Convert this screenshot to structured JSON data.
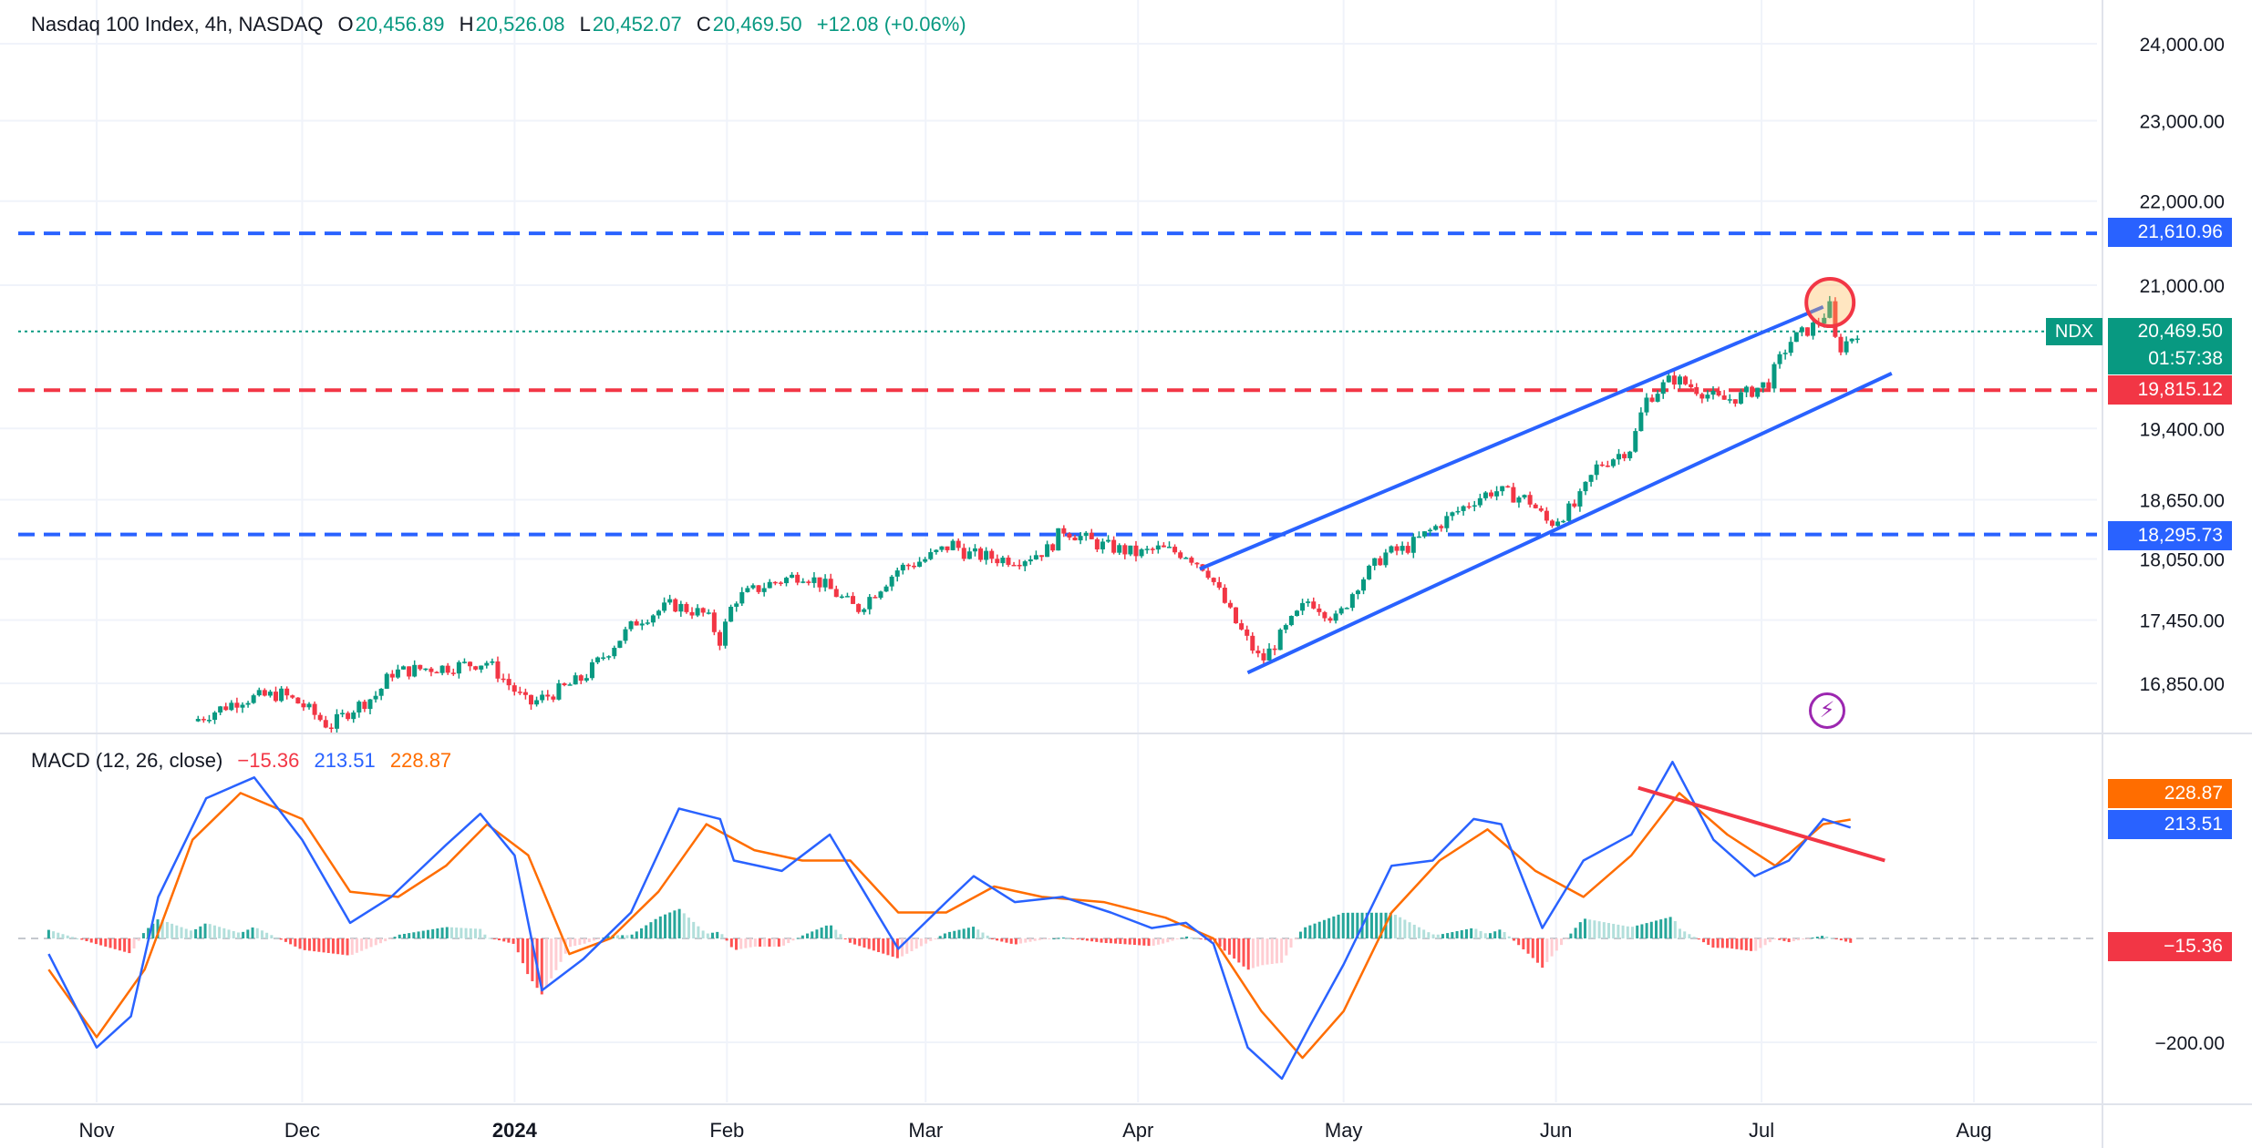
{
  "header": {
    "symbol": "Nasdaq 100 Index, 4h, NASDAQ",
    "o_label": "O",
    "o_val": "20,456.89",
    "h_label": "H",
    "h_val": "20,526.08",
    "l_label": "L",
    "l_val": "20,452.07",
    "c_label": "C",
    "c_val": "20,469.50",
    "change": "+12.08 (+0.06%)"
  },
  "macd_header": {
    "label": "MACD (12, 26, close)",
    "hist": "−15.36",
    "macd": "213.51",
    "signal": "228.87"
  },
  "price_tags": {
    "resistance_upper": "21,610.96",
    "resistance_red": "19,815.12",
    "support_lower": "18,295.73",
    "symbol": "NDX",
    "last": "20,469.50",
    "countdown": "01:57:38",
    "macd_signal": "228.87",
    "macd_line": "213.51",
    "macd_hist": "−15.36"
  },
  "colors": {
    "up": "#089981",
    "down": "#f23645",
    "blue_line": "#2962ff",
    "red_line": "#f23645",
    "macd_line": "#2962ff",
    "signal_line": "#ff6d00",
    "signal_tag": "#ff6d00",
    "bolt": "#9c27b0"
  },
  "icons": {
    "indicator": "bolt-icon"
  },
  "chart_data": [
    {
      "type": "candlestick",
      "title": "Nasdaq 100 Index, 4h, NASDAQ",
      "x_ticks": [
        "Nov",
        "Dec",
        "2024",
        "Feb",
        "Mar",
        "Apr",
        "May",
        "Jun",
        "Jul",
        "Aug"
      ],
      "y_ticks": [
        24000,
        23000,
        22000,
        21000,
        19400,
        18650,
        18050,
        17450,
        16850
      ],
      "y_tick_labels": [
        "24,000.00",
        "23,000.00",
        "22,000.00",
        "21,000.00",
        "19,400.00",
        "18,650.00",
        "18,050.00",
        "17,450.00",
        "16,850.00"
      ],
      "scale": "log",
      "horizontal_levels": [
        {
          "value": 21610.96,
          "color": "#2962ff",
          "style": "dashed"
        },
        {
          "value": 19815.12,
          "color": "#f23645",
          "style": "dashed"
        },
        {
          "value": 18295.73,
          "color": "#2962ff",
          "style": "dashed"
        },
        {
          "value": 20469.5,
          "color": "#089981",
          "style": "dotted"
        }
      ],
      "channel": {
        "upper": [
          [
            "2024-04-10",
            17950
          ],
          [
            "2024-07-10",
            20750
          ]
        ],
        "lower": [
          [
            "2024-04-17",
            16950
          ],
          [
            "2024-07-20",
            20000
          ]
        ]
      },
      "highlight_circle": {
        "date": "2024-07-11",
        "value": 20800
      },
      "closes": [
        [
          "2023-11-15",
          16500
        ],
        [
          "2023-11-22",
          16700
        ],
        [
          "2023-11-28",
          16750
        ],
        [
          "2023-12-01",
          16650
        ],
        [
          "2023-12-05",
          16450
        ],
        [
          "2023-12-08",
          16600
        ],
        [
          "2023-12-12",
          16750
        ],
        [
          "2023-12-14",
          16950
        ],
        [
          "2023-12-19",
          16990
        ],
        [
          "2023-12-22",
          17000
        ],
        [
          "2023-12-28",
          17050
        ],
        [
          "2024-01-03",
          16650
        ],
        [
          "2024-01-08",
          16800
        ],
        [
          "2024-01-11",
          16900
        ],
        [
          "2024-01-16",
          17250
        ],
        [
          "2024-01-19",
          17450
        ],
        [
          "2024-01-24",
          17600
        ],
        [
          "2024-01-29",
          17500
        ],
        [
          "2024-01-31",
          17250
        ],
        [
          "2024-02-02",
          17650
        ],
        [
          "2024-02-07",
          17800
        ],
        [
          "2024-02-12",
          17900
        ],
        [
          "2024-02-15",
          17800
        ],
        [
          "2024-02-20",
          17550
        ],
        [
          "2024-02-26",
          17950
        ],
        [
          "2024-03-01",
          18050
        ],
        [
          "2024-03-05",
          18200
        ],
        [
          "2024-03-07",
          18100
        ],
        [
          "2024-03-12",
          18050
        ],
        [
          "2024-03-15",
          18050
        ],
        [
          "2024-03-19",
          18150
        ],
        [
          "2024-03-21",
          18350
        ],
        [
          "2024-03-26",
          18200
        ],
        [
          "2024-04-01",
          18100
        ],
        [
          "2024-04-04",
          18150
        ],
        [
          "2024-04-08",
          18100
        ],
        [
          "2024-04-11",
          17950
        ],
        [
          "2024-04-15",
          17450
        ],
        [
          "2024-04-19",
          17050
        ],
        [
          "2024-04-23",
          17400
        ],
        [
          "2024-04-26",
          17650
        ],
        [
          "2024-04-30",
          17450
        ],
        [
          "2024-05-03",
          17800
        ],
        [
          "2024-05-07",
          18100
        ],
        [
          "2024-05-10",
          18150
        ],
        [
          "2024-05-15",
          18400
        ],
        [
          "2024-05-20",
          18650
        ],
        [
          "2024-05-23",
          18750
        ],
        [
          "2024-05-28",
          18650
        ],
        [
          "2024-05-31",
          18400
        ],
        [
          "2024-06-04",
          18600
        ],
        [
          "2024-06-07",
          19000
        ],
        [
          "2024-06-12",
          19200
        ],
        [
          "2024-06-14",
          19700
        ],
        [
          "2024-06-18",
          19950
        ],
        [
          "2024-06-21",
          19850
        ],
        [
          "2024-06-25",
          19700
        ],
        [
          "2024-06-28",
          19750
        ],
        [
          "2024-07-02",
          19900
        ],
        [
          "2024-07-05",
          20350
        ],
        [
          "2024-07-09",
          20550
        ],
        [
          "2024-07-11",
          20750
        ],
        [
          "2024-07-12",
          20250
        ],
        [
          "2024-07-15",
          20469.5
        ]
      ]
    },
    {
      "type": "macd",
      "title": "MACD (12, 26, close)",
      "y_ticks": [
        -200
      ],
      "y_tick_labels": [
        "−200.00"
      ],
      "last": {
        "hist": -15.36,
        "macd": 213.51,
        "signal": 228.87
      },
      "divergence_line": [
        [
          "2024-06-13",
          290
        ],
        [
          "2024-07-19",
          150
        ]
      ],
      "macd": [
        [
          "2023-10-25",
          -30
        ],
        [
          "2023-11-01",
          -210
        ],
        [
          "2023-11-06",
          -150
        ],
        [
          "2023-11-10",
          80
        ],
        [
          "2023-11-17",
          270
        ],
        [
          "2023-11-24",
          310
        ],
        [
          "2023-12-01",
          190
        ],
        [
          "2023-12-08",
          30
        ],
        [
          "2023-12-14",
          80
        ],
        [
          "2023-12-22",
          180
        ],
        [
          "2023-12-27",
          240
        ],
        [
          "2024-01-01",
          160
        ],
        [
          "2024-01-05",
          -100
        ],
        [
          "2024-01-11",
          -40
        ],
        [
          "2024-01-18",
          50
        ],
        [
          "2024-01-25",
          250
        ],
        [
          "2024-01-31",
          230
        ],
        [
          "2024-02-02",
          150
        ],
        [
          "2024-02-09",
          130
        ],
        [
          "2024-02-16",
          200
        ],
        [
          "2024-02-21",
          90
        ],
        [
          "2024-02-26",
          -20
        ],
        [
          "2024-03-04",
          70
        ],
        [
          "2024-03-08",
          120
        ],
        [
          "2024-03-14",
          70
        ],
        [
          "2024-03-21",
          80
        ],
        [
          "2024-03-28",
          50
        ],
        [
          "2024-04-03",
          20
        ],
        [
          "2024-04-08",
          30
        ],
        [
          "2024-04-12",
          -10
        ],
        [
          "2024-04-17",
          -210
        ],
        [
          "2024-04-22",
          -270
        ],
        [
          "2024-04-26",
          -170
        ],
        [
          "2024-05-01",
          -50
        ],
        [
          "2024-05-08",
          140
        ],
        [
          "2024-05-14",
          150
        ],
        [
          "2024-05-20",
          230
        ],
        [
          "2024-05-24",
          220
        ],
        [
          "2024-05-30",
          20
        ],
        [
          "2024-06-05",
          150
        ],
        [
          "2024-06-12",
          200
        ],
        [
          "2024-06-18",
          340
        ],
        [
          "2024-06-24",
          190
        ],
        [
          "2024-06-30",
          120
        ],
        [
          "2024-07-05",
          150
        ],
        [
          "2024-07-10",
          230
        ],
        [
          "2024-07-14",
          213.51
        ]
      ],
      "signal": [
        [
          "2023-10-25",
          -60
        ],
        [
          "2023-11-01",
          -190
        ],
        [
          "2023-11-08",
          -60
        ],
        [
          "2023-11-15",
          190
        ],
        [
          "2023-11-22",
          280
        ],
        [
          "2023-12-01",
          230
        ],
        [
          "2023-12-08",
          90
        ],
        [
          "2023-12-15",
          80
        ],
        [
          "2023-12-22",
          140
        ],
        [
          "2023-12-28",
          220
        ],
        [
          "2024-01-03",
          160
        ],
        [
          "2024-01-09",
          -30
        ],
        [
          "2024-01-15",
          0
        ],
        [
          "2024-01-22",
          90
        ],
        [
          "2024-01-29",
          220
        ],
        [
          "2024-02-05",
          170
        ],
        [
          "2024-02-12",
          150
        ],
        [
          "2024-02-19",
          150
        ],
        [
          "2024-02-26",
          50
        ],
        [
          "2024-03-04",
          50
        ],
        [
          "2024-03-11",
          100
        ],
        [
          "2024-03-18",
          80
        ],
        [
          "2024-03-27",
          70
        ],
        [
          "2024-04-05",
          40
        ],
        [
          "2024-04-12",
          0
        ],
        [
          "2024-04-19",
          -140
        ],
        [
          "2024-04-25",
          -230
        ],
        [
          "2024-05-01",
          -140
        ],
        [
          "2024-05-08",
          50
        ],
        [
          "2024-05-15",
          150
        ],
        [
          "2024-05-22",
          210
        ],
        [
          "2024-05-29",
          130
        ],
        [
          "2024-06-05",
          80
        ],
        [
          "2024-06-12",
          160
        ],
        [
          "2024-06-19",
          280
        ],
        [
          "2024-06-26",
          200
        ],
        [
          "2024-07-03",
          140
        ],
        [
          "2024-07-10",
          220
        ],
        [
          "2024-07-14",
          228.87
        ]
      ]
    }
  ]
}
